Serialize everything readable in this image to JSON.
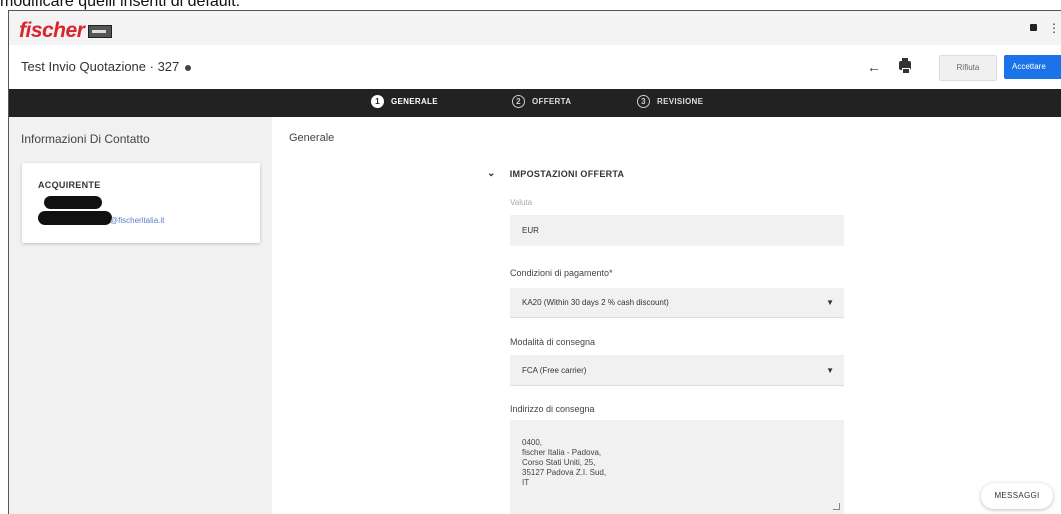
{
  "caption": "modificare quelli inseriti di default.",
  "header": {
    "logo_text": "fischer"
  },
  "title_bar": {
    "title": "Test Invio Quotazione · 327",
    "reject_label": "Rifiuta",
    "accept_label": "Accettare"
  },
  "stepper": {
    "steps": [
      {
        "num": "1",
        "label": "GENERALE",
        "active": true
      },
      {
        "num": "2",
        "label": "OFFERTA",
        "active": false
      },
      {
        "num": "3",
        "label": "REVISIONE",
        "active": false
      }
    ]
  },
  "sidebar": {
    "title": "Informazioni Di Contatto",
    "card_label": "ACQUIRENTE",
    "email_suffix": "@fischeritalia.it"
  },
  "main": {
    "title": "Generale",
    "section_title": "IMPOSTAZIONI OFFERTA",
    "currency": {
      "label": "Valuta",
      "value": "EUR"
    },
    "payment": {
      "label": "Condizioni di pagamento*",
      "value": "KA20 (Within 30 days 2 % cash discount)"
    },
    "delivery": {
      "label": "Modalità di consegna",
      "value": "FCA (Free carrier)"
    },
    "address": {
      "label": "Indirizzo di consegna",
      "value": "0400,\n fischer Italia - Padova,\n Corso Stati Uniti, 25,\n 35127 Padova Z.I. Sud,\n IT"
    }
  },
  "messages_label": "MESSAGGI",
  "colors": {
    "brand": "#d8262f",
    "primary": "#1a73e8",
    "stepper_bg": "#222222"
  }
}
